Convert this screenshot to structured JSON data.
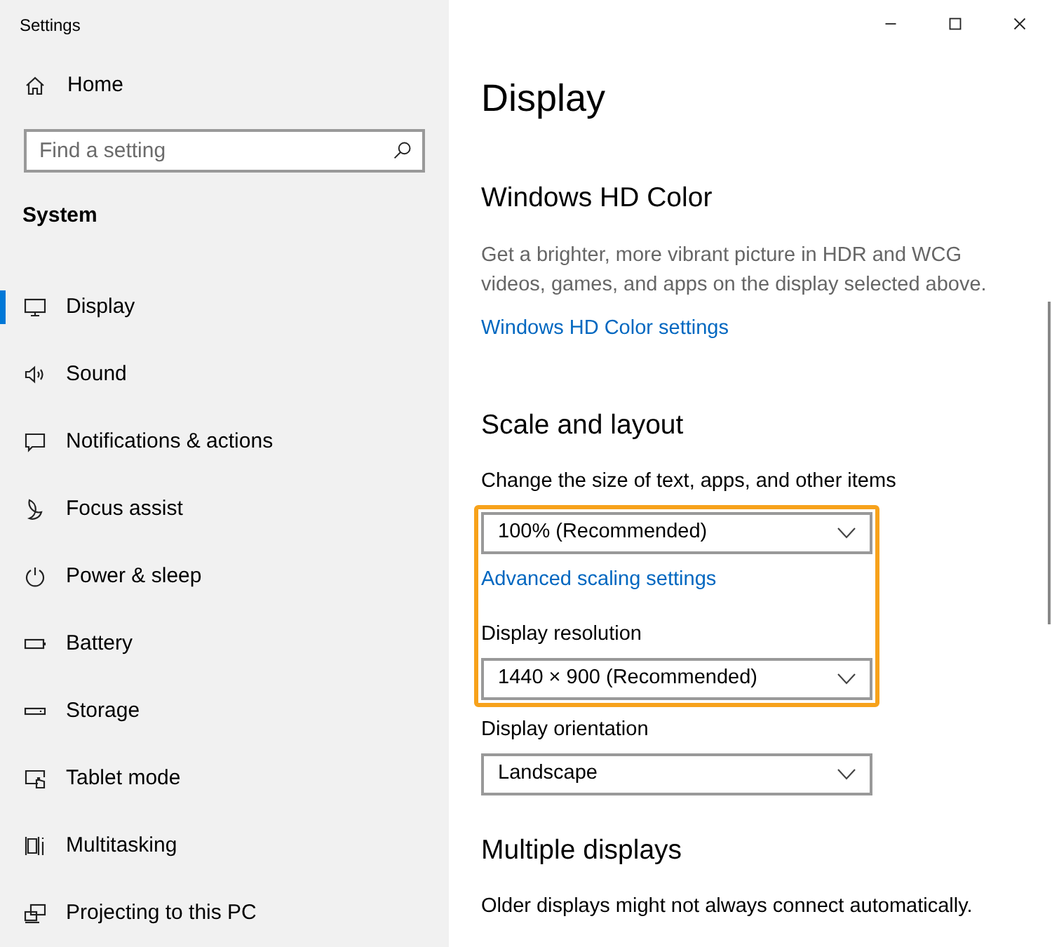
{
  "window": {
    "title": "Settings"
  },
  "sidebar": {
    "home": "Home",
    "search": {
      "placeholder": "Find a setting"
    },
    "group": "System",
    "items": [
      {
        "label": "Display",
        "selected": true
      },
      {
        "label": "Sound",
        "selected": false
      },
      {
        "label": "Notifications & actions",
        "selected": false
      },
      {
        "label": "Focus assist",
        "selected": false
      },
      {
        "label": "Power & sleep",
        "selected": false
      },
      {
        "label": "Battery",
        "selected": false
      },
      {
        "label": "Storage",
        "selected": false
      },
      {
        "label": "Tablet mode",
        "selected": false
      },
      {
        "label": "Multitasking",
        "selected": false
      },
      {
        "label": "Projecting to this PC",
        "selected": false
      }
    ]
  },
  "page": {
    "title": "Display",
    "sections": [
      {
        "heading": "Windows HD Color",
        "items": [
          {
            "kind": "description",
            "text": "Get a brighter, more vibrant picture in HDR and WCG videos, games, and apps on the display selected above.",
            "highlighted": false
          },
          {
            "kind": "link",
            "text": "Windows HD Color settings",
            "highlighted": false
          }
        ]
      },
      {
        "heading": "Scale and layout",
        "items": [
          {
            "kind": "label",
            "text": "Change the size of text, apps, and other items",
            "highlighted": false
          },
          {
            "kind": "dropdown",
            "text": "100% (Recommended)",
            "highlighted": true
          },
          {
            "kind": "link",
            "text": "Advanced scaling settings",
            "highlighted": true
          },
          {
            "kind": "label",
            "text": "Display resolution",
            "highlighted": true
          },
          {
            "kind": "dropdown",
            "text": "1440 × 900 (Recommended)",
            "highlighted": true
          },
          {
            "kind": "label",
            "text": "Display orientation",
            "highlighted": false
          },
          {
            "kind": "dropdown",
            "text": "Landscape",
            "highlighted": false
          }
        ]
      },
      {
        "heading": "Multiple displays",
        "items": [
          {
            "kind": "label",
            "text": "Older displays might not always connect automatically.",
            "highlighted": false
          }
        ]
      }
    ]
  }
}
